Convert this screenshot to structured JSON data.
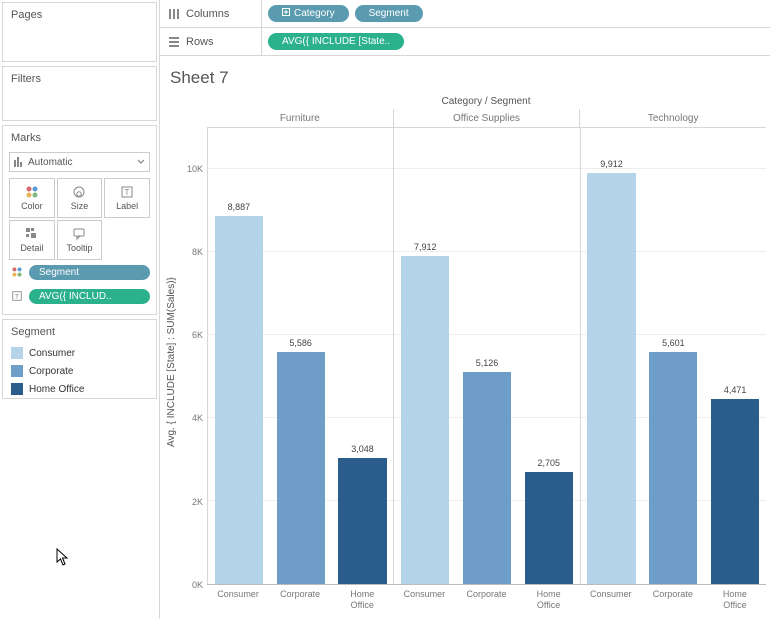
{
  "panels": {
    "pages_title": "Pages",
    "filters_title": "Filters",
    "marks_title": "Marks",
    "marks_dropdown": "Automatic",
    "mark_cells": [
      "Color",
      "Size",
      "Label",
      "Detail",
      "Tooltip"
    ],
    "mark_pills": {
      "segment": "Segment",
      "include": "AVG({ INCLUD.."
    },
    "legend_title": "Segment",
    "legend_items": [
      {
        "label": "Consumer",
        "color": "#b6d4e9"
      },
      {
        "label": "Corporate",
        "color": "#6e9ec8"
      },
      {
        "label": "Home Office",
        "color": "#2b5d8c"
      }
    ]
  },
  "shelves": {
    "columns_label": "Columns",
    "columns_pills": [
      "Category",
      "Segment"
    ],
    "rows_label": "Rows",
    "rows_pills": [
      "AVG({ INCLUDE [State.."
    ]
  },
  "sheet_title": "Sheet 7",
  "axis_top_title": "Category / Segment",
  "y_axis_label": "Avg. { INCLUDE [State] : SUM(Sales)}",
  "chart_data": {
    "type": "bar",
    "ylabel": "Avg. { INCLUDE [State] : SUM(Sales)}",
    "ylim": [
      0,
      11000
    ],
    "yticks": [
      0,
      2000,
      4000,
      6000,
      8000,
      10000
    ],
    "ytick_labels": [
      "0K",
      "2K",
      "4K",
      "6K",
      "8K",
      "10K"
    ],
    "categories": [
      "Furniture",
      "Office Supplies",
      "Technology"
    ],
    "segments": [
      "Consumer",
      "Corporate",
      "Home Office"
    ],
    "segment_colors": {
      "Consumer": "#b6d4e9",
      "Corporate": "#6e9ec8",
      "Home Office": "#2b5d8c"
    },
    "series": [
      {
        "category": "Furniture",
        "segment": "Consumer",
        "value": 8887,
        "label": "8,887"
      },
      {
        "category": "Furniture",
        "segment": "Corporate",
        "value": 5586,
        "label": "5,586"
      },
      {
        "category": "Furniture",
        "segment": "Home Office",
        "value": 3048,
        "label": "3,048"
      },
      {
        "category": "Office Supplies",
        "segment": "Consumer",
        "value": 7912,
        "label": "7,912"
      },
      {
        "category": "Office Supplies",
        "segment": "Corporate",
        "value": 5126,
        "label": "5,126"
      },
      {
        "category": "Office Supplies",
        "segment": "Home Office",
        "value": 2705,
        "label": "2,705"
      },
      {
        "category": "Technology",
        "segment": "Consumer",
        "value": 9912,
        "label": "9,912"
      },
      {
        "category": "Technology",
        "segment": "Corporate",
        "value": 5601,
        "label": "5,601"
      },
      {
        "category": "Technology",
        "segment": "Home Office",
        "value": 4471,
        "label": "4,471"
      }
    ],
    "xtick_wrap": {
      "Home Office": "Home<br>Office"
    }
  }
}
